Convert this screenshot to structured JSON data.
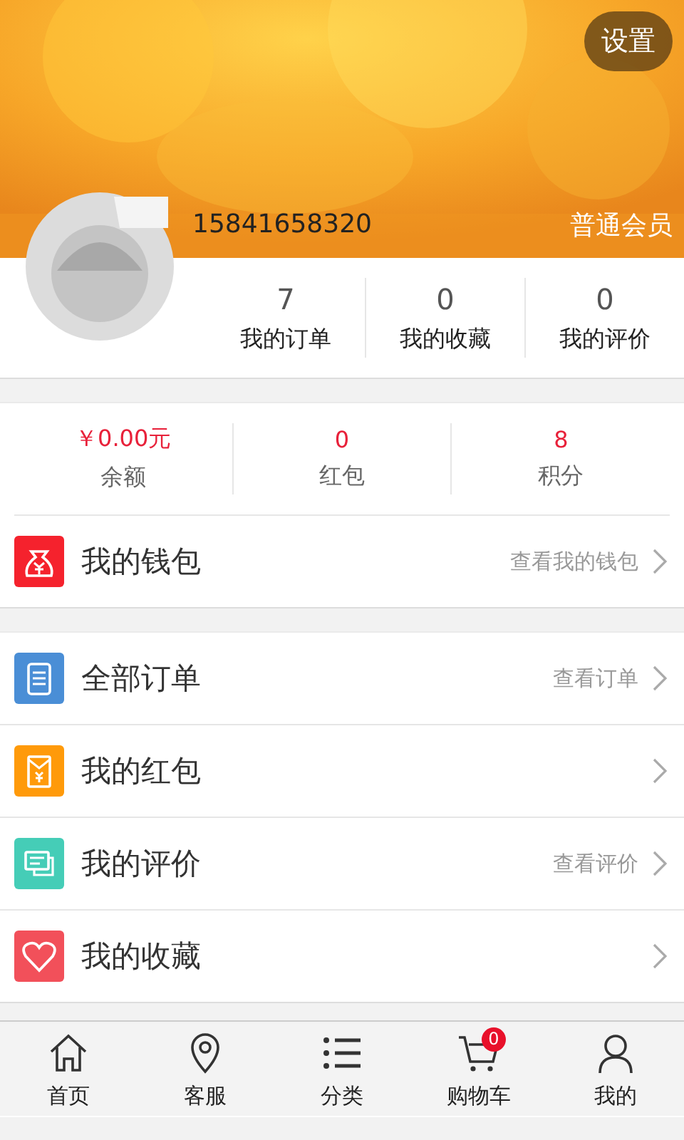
{
  "header": {
    "settings_button": "设置",
    "phone": "15841658320",
    "member_level": "普通会员"
  },
  "profile_stats": [
    {
      "value": "7",
      "label": "我的订单"
    },
    {
      "value": "0",
      "label": "我的收藏"
    },
    {
      "value": "0",
      "label": "我的评价"
    }
  ],
  "wallet_stats": [
    {
      "value": "￥0.00元",
      "label": "余额"
    },
    {
      "value": "0",
      "label": "红包"
    },
    {
      "value": "8",
      "label": "积分"
    }
  ],
  "wallet_row": {
    "kind": "wallet",
    "title": "我的钱包",
    "hint": "查看我的钱包",
    "color": "#f5222d"
  },
  "menu": [
    {
      "kind": "orders",
      "title": "全部订单",
      "hint": "查看订单",
      "color": "#4a8ed6"
    },
    {
      "kind": "redpacket",
      "title": "我的红包",
      "color": "#ff9a0a"
    },
    {
      "kind": "comment",
      "title": "我的评价",
      "hint": "查看评价",
      "color": "#45cdb7"
    },
    {
      "kind": "favorite",
      "title": "我的收藏",
      "color": "#f2505a"
    }
  ],
  "tab_bar": [
    {
      "kind": "home",
      "label": "首页"
    },
    {
      "kind": "location",
      "label": "客服"
    },
    {
      "kind": "list",
      "label": "分类"
    },
    {
      "kind": "cart",
      "label": "购物车",
      "badge": "0"
    },
    {
      "kind": "user",
      "label": "我的"
    }
  ]
}
